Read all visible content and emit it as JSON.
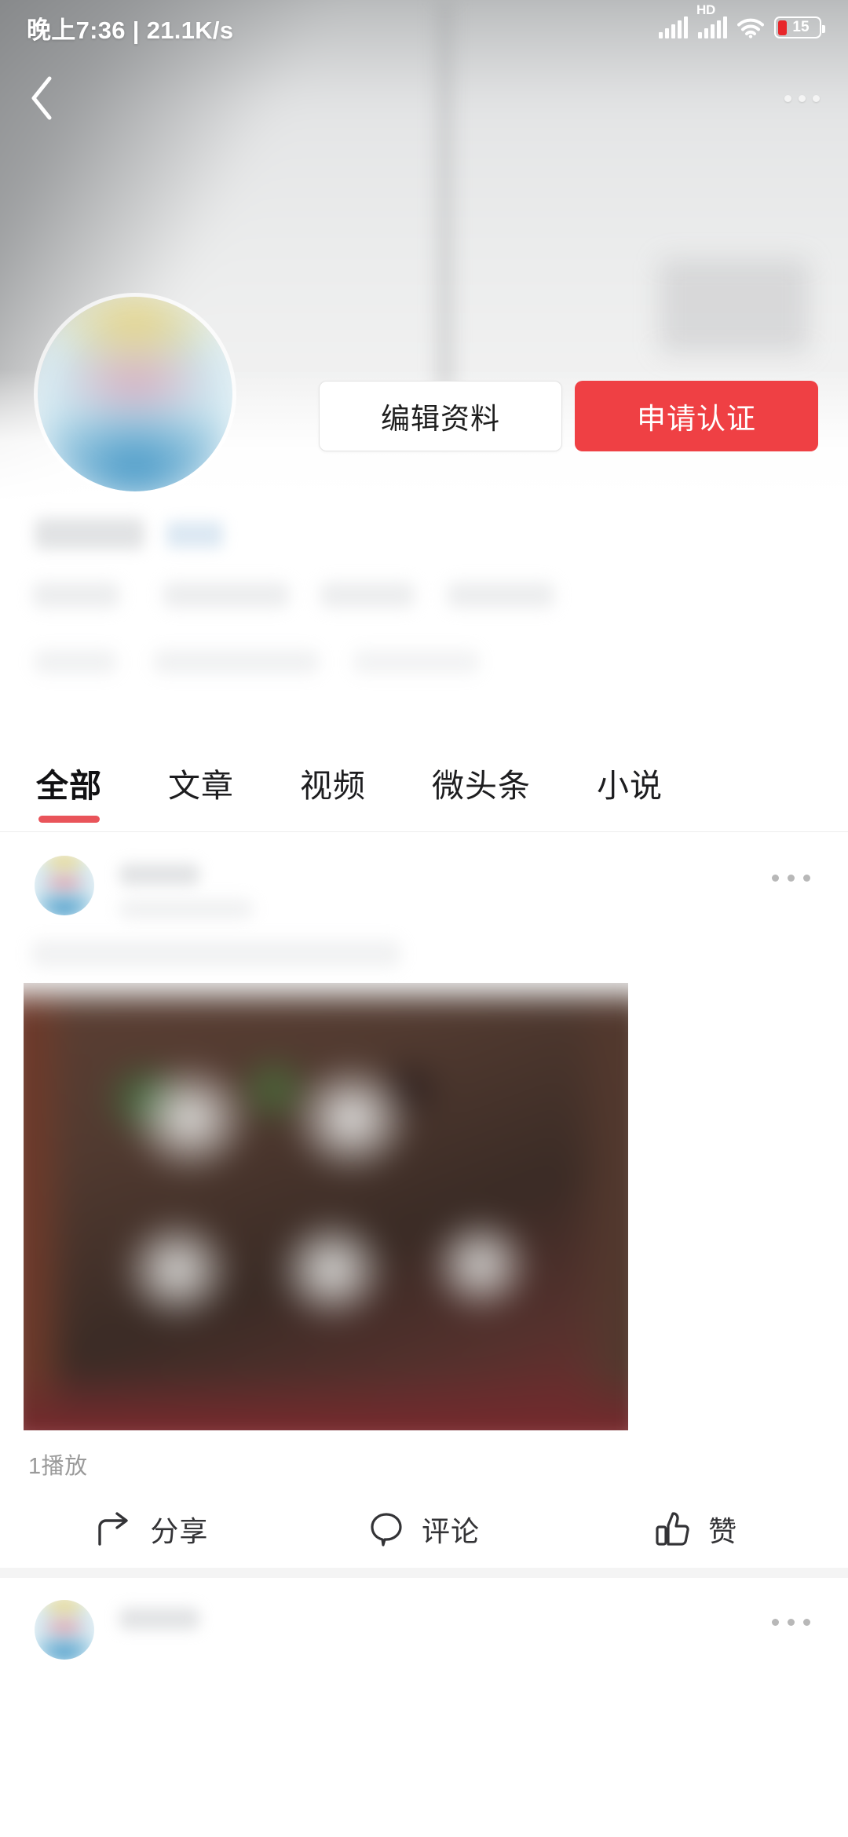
{
  "status_bar": {
    "time": "晚上7:36",
    "separator": "|",
    "network_speed": "21.1K/s",
    "hd_label": "HD",
    "battery_percent": "15",
    "icons": [
      "signal-icon",
      "signal-hd-icon",
      "wifi-icon",
      "battery-icon"
    ]
  },
  "top_nav": {
    "back_icon": "back-chevron-icon",
    "more_icon": "more-options-icon"
  },
  "profile": {
    "avatar_icon": "profile-avatar-emblem",
    "name_redacted": true,
    "buttons": {
      "edit_label": "编辑资料",
      "verify_label": "申请认证"
    },
    "accent_color": "#ef4044"
  },
  "tabs": {
    "active_index": 0,
    "underline_color": "#e9545a",
    "items": [
      {
        "label": "全部"
      },
      {
        "label": "文章"
      },
      {
        "label": "视频"
      },
      {
        "label": "微头条"
      },
      {
        "label": "小说"
      }
    ]
  },
  "feed": {
    "posts": [
      {
        "author_avatar_icon": "post-author-avatar",
        "more_icon": "post-more-options-icon",
        "play_count": "1播放",
        "actions": [
          {
            "label": "分享",
            "icon": "share-arrow-icon"
          },
          {
            "label": "评论",
            "icon": "comment-bubble-icon"
          },
          {
            "label": "赞",
            "icon": "thumbs-up-icon"
          }
        ]
      },
      {
        "author_avatar_icon": "post-author-avatar",
        "more_icon": "post-more-options-icon"
      }
    ]
  }
}
